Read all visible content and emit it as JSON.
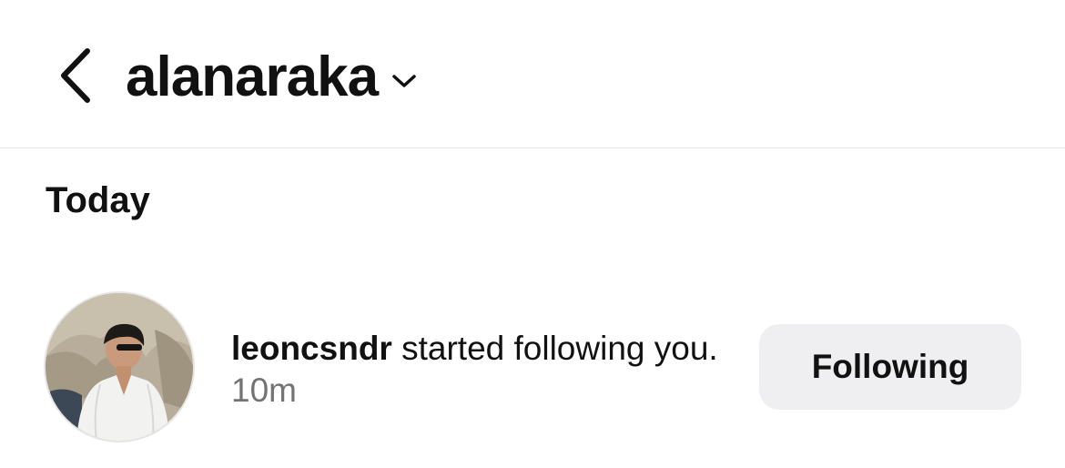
{
  "header": {
    "username": "alanaraka",
    "back_icon": "chevron-left-icon",
    "dropdown_icon": "chevron-down-icon"
  },
  "section": {
    "title": "Today"
  },
  "notifications": [
    {
      "username": "leoncsndr",
      "message": "started following you.",
      "time": "10m",
      "button_label": "Following"
    }
  ],
  "colors": {
    "background": "#ffffff",
    "text": "#111111",
    "muted": "#737373",
    "button_bg": "#efeff2",
    "divider": "#e4e4e6"
  }
}
